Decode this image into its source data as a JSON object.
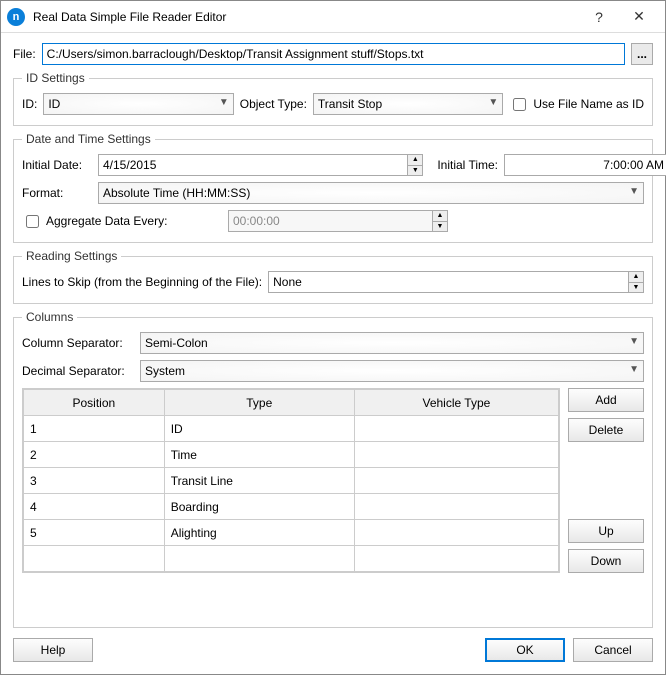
{
  "titlebar": {
    "title": "Real Data Simple File Reader Editor",
    "app_icon_letter": "n"
  },
  "file": {
    "label": "File:",
    "path": "C:/Users/simon.barraclough/Desktop/Transit Assignment stuff/Stops.txt",
    "browse": "..."
  },
  "id_settings": {
    "legend": "ID Settings",
    "id_label": "ID:",
    "id_value": "ID",
    "obj_type_label": "Object Type:",
    "obj_type_value": "Transit Stop",
    "use_filename_label": "Use File Name as ID"
  },
  "datetime": {
    "legend": "Date and Time Settings",
    "initial_date_label": "Initial Date:",
    "initial_date_value": "4/15/2015",
    "initial_time_label": "Initial Time:",
    "initial_time_value": "7:00:00 AM",
    "format_label": "Format:",
    "format_value": "Absolute Time (HH:MM:SS)",
    "aggregate_label": "Aggregate Data Every:",
    "aggregate_value": "00:00:00"
  },
  "reading": {
    "legend": "Reading Settings",
    "lines_skip_label": "Lines to Skip (from the Beginning of the File):",
    "lines_skip_value": "None"
  },
  "columns": {
    "legend": "Columns",
    "col_sep_label": "Column Separator:",
    "col_sep_value": "Semi-Colon",
    "dec_sep_label": "Decimal Separator:",
    "dec_sep_value": "System",
    "headers": {
      "position": "Position",
      "type": "Type",
      "vehicle": "Vehicle Type"
    },
    "rows": [
      {
        "position": "1",
        "type": "ID",
        "vehicle": ""
      },
      {
        "position": "2",
        "type": "Time",
        "vehicle": ""
      },
      {
        "position": "3",
        "type": "Transit Line",
        "vehicle": ""
      },
      {
        "position": "4",
        "type": "Boarding",
        "vehicle": ""
      },
      {
        "position": "5",
        "type": "Alighting",
        "vehicle": ""
      }
    ],
    "buttons": {
      "add": "Add",
      "delete": "Delete",
      "up": "Up",
      "down": "Down"
    }
  },
  "footer": {
    "help": "Help",
    "ok": "OK",
    "cancel": "Cancel"
  }
}
